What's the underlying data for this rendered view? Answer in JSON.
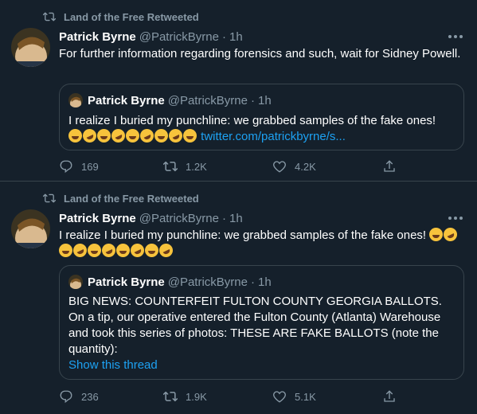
{
  "tweets": [
    {
      "retweeted_by": "Land of the Free Retweeted",
      "author": {
        "name": "Patrick Byrne",
        "handle": "@PatrickByrne",
        "time": "1h"
      },
      "text": "For further information regarding forensics and such, wait for Sidney Powell.",
      "quote": {
        "author": {
          "name": "Patrick Byrne",
          "handle": "@PatrickByrne",
          "time": "1h"
        },
        "text": "I realize I buried my punchline: we grabbed samples of the fake ones!",
        "emoji_count": 9,
        "link": "twitter.com/patrickbyrne/s..."
      },
      "actions": {
        "replies": "169",
        "retweets": "1.2K",
        "likes": "4.2K"
      }
    },
    {
      "retweeted_by": "Land of the Free Retweeted",
      "author": {
        "name": "Patrick Byrne",
        "handle": "@PatrickByrne",
        "time": "1h"
      },
      "text": "I realize I buried my punchline: we grabbed samples of the fake ones!",
      "emoji_count": 10,
      "quote": {
        "author": {
          "name": "Patrick Byrne",
          "handle": "@PatrickByrne",
          "time": "1h"
        },
        "text": "BIG NEWS: COUNTERFEIT FULTON COUNTY GEORGIA BALLOTS. On a tip, our operative entered the Fulton County (Atlanta) Warehouse and took this series of photos: THESE ARE FAKE BALLOTS (note the quantity):",
        "show_thread": "Show this thread"
      },
      "actions": {
        "replies": "236",
        "retweets": "1.9K",
        "likes": "5.1K"
      }
    }
  ],
  "colors": {
    "background": "#15202b",
    "secondary_text": "#8899a6",
    "link": "#1da1f2",
    "border": "#38444d"
  },
  "icons": [
    "retweet-icon",
    "more-icon",
    "reply-icon",
    "like-icon",
    "share-icon",
    "laughing-emoji-icon",
    "rolling-laughing-emoji-icon"
  ]
}
